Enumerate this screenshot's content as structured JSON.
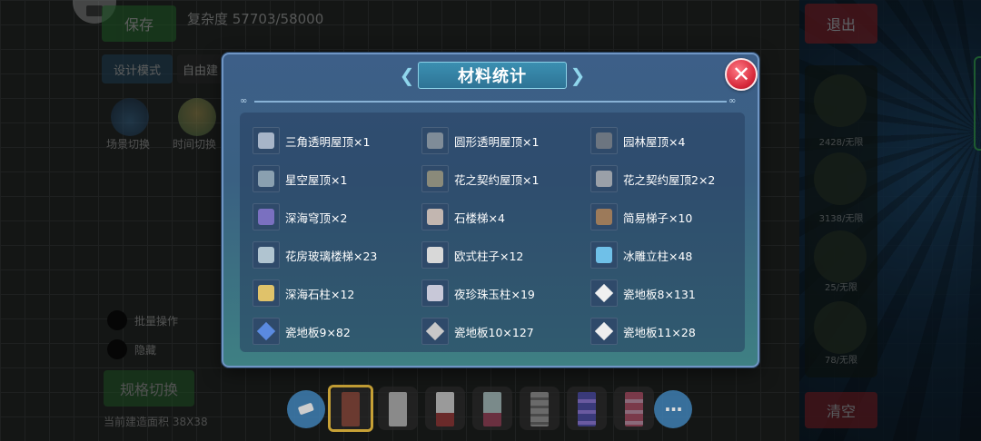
{
  "background": {
    "save_label": "保存",
    "complexity": "复杂度 57703/58000",
    "mode_label": "设计模式",
    "free_label": "自由建",
    "scene_switch": "场景切换",
    "time_switch": "时间切换",
    "batch_op": "批量操作",
    "hide": "隐藏",
    "grid_switch": "规格切换",
    "area_text": "当前建造面积 38X38",
    "exit_label": "退出",
    "clear_label": "清空",
    "inventory_counts": [
      "2428/无限",
      "3138/无限",
      "25/无限",
      "78/无限"
    ]
  },
  "modal": {
    "title": "材料统计",
    "close_icon": "close-icon",
    "items": [
      {
        "label": "三角透明屋顶×1",
        "icon": "triangle-glass-roof-icon"
      },
      {
        "label": "圆形透明屋顶×1",
        "icon": "round-glass-roof-icon"
      },
      {
        "label": "园林屋顶×4",
        "icon": "garden-roof-icon"
      },
      {
        "label": "星空屋顶×1",
        "icon": "starry-roof-icon"
      },
      {
        "label": "花之契约屋顶×1",
        "icon": "flower-pact-roof-icon"
      },
      {
        "label": "花之契约屋顶2×2",
        "icon": "flower-pact-roof-2-icon"
      },
      {
        "label": "深海穹顶×2",
        "icon": "deep-sea-dome-icon"
      },
      {
        "label": "石楼梯×4",
        "icon": "stone-stairs-icon"
      },
      {
        "label": "简易梯子×10",
        "icon": "simple-ladder-icon"
      },
      {
        "label": "花房玻璃楼梯×23",
        "icon": "greenhouse-glass-stairs-icon"
      },
      {
        "label": "欧式柱子×12",
        "icon": "european-pillar-icon"
      },
      {
        "label": "冰雕立柱×48",
        "icon": "ice-pillar-icon"
      },
      {
        "label": "深海石柱×12",
        "icon": "deep-sea-stone-pillar-icon"
      },
      {
        "label": "夜珍珠玉柱×19",
        "icon": "night-pearl-jade-pillar-icon"
      },
      {
        "label": "瓷地板8×131",
        "icon": "tile-floor-8-icon"
      },
      {
        "label": "瓷地板9×82",
        "icon": "tile-floor-9-icon"
      },
      {
        "label": "瓷地板10×127",
        "icon": "tile-floor-10-icon"
      },
      {
        "label": "瓷地板11×28",
        "icon": "tile-floor-11-icon"
      }
    ]
  },
  "toolbar": {
    "eraser_icon": "eraser-icon",
    "more_icon": "more-icon",
    "more_label": "···"
  }
}
